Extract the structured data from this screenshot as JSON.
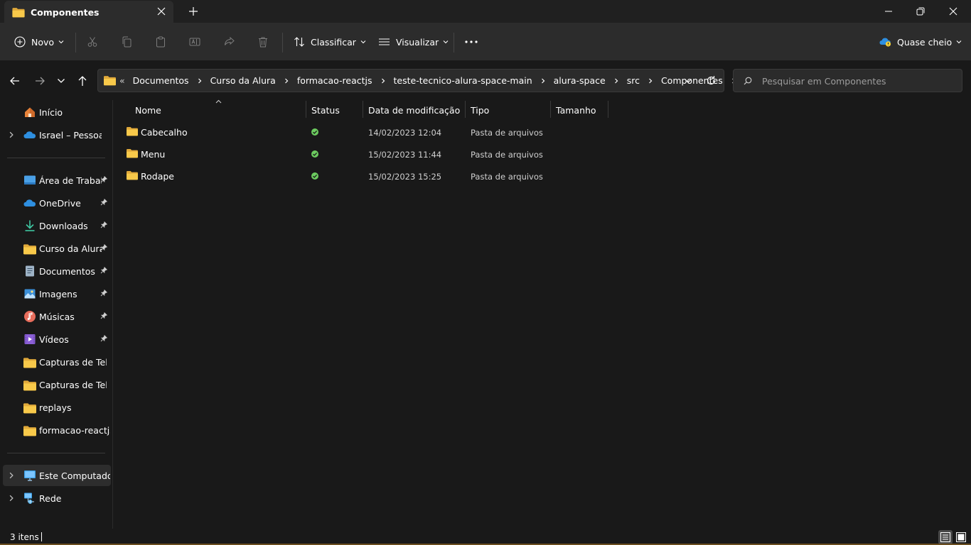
{
  "window": {
    "tab_title": "Componentes",
    "icons": {
      "tab": "folder-icon",
      "close_tab": "close-icon",
      "new_tab": "plus-icon",
      "minimize": "minimize-icon",
      "maximize": "restore-icon",
      "close": "close-icon"
    }
  },
  "toolbar": {
    "new_label": "Novo",
    "sort_label": "Classificar",
    "view_label": "Visualizar",
    "storage_label": "Quase cheio",
    "icons": [
      "cut-icon",
      "copy-icon",
      "paste-icon",
      "rename-icon",
      "share-icon",
      "delete-icon",
      "more-icon"
    ]
  },
  "address": {
    "overflow": "«",
    "crumbs": [
      "Documentos",
      "Curso da Alura",
      "formacao-reactjs",
      "teste-tecnico-alura-space-main",
      "alura-space",
      "src",
      "Componentes"
    ],
    "search_placeholder": "Pesquisar em Componentes"
  },
  "sidebar": {
    "items": [
      {
        "label": "Início",
        "icon": "home-icon"
      },
      {
        "label": "Israel – Pessoal",
        "icon": "onedrive-cloud-icon"
      },
      {
        "label": "Área de Trabalho",
        "icon": "desktop-icon"
      },
      {
        "label": "OneDrive",
        "icon": "onedrive-cloud-icon"
      },
      {
        "label": "Downloads",
        "icon": "download-icon"
      },
      {
        "label": "Curso da Alura",
        "icon": "folder-icon"
      },
      {
        "label": "Documentos",
        "icon": "documents-icon"
      },
      {
        "label": "Imagens",
        "icon": "pictures-icon"
      },
      {
        "label": "Músicas",
        "icon": "music-icon"
      },
      {
        "label": "Vídeos",
        "icon": "videos-icon"
      },
      {
        "label": "Capturas de Tela",
        "icon": "folder-icon"
      },
      {
        "label": "Capturas de Tela",
        "icon": "folder-icon"
      },
      {
        "label": "replays",
        "icon": "folder-icon"
      },
      {
        "label": "formacao-reactjs",
        "icon": "folder-icon"
      },
      {
        "label": "Este Computador",
        "icon": "computer-icon"
      },
      {
        "label": "Rede",
        "icon": "network-icon"
      }
    ]
  },
  "columns": {
    "name": "Nome",
    "status": "Status",
    "date": "Data de modificação",
    "type": "Tipo",
    "size": "Tamanho"
  },
  "files": [
    {
      "name": "Cabecalho",
      "date": "14/02/2023 12:04",
      "type": "Pasta de arquivos",
      "size": ""
    },
    {
      "name": "Menu",
      "date": "15/02/2023 11:44",
      "type": "Pasta de arquivos",
      "size": ""
    },
    {
      "name": "Rodape",
      "date": "15/02/2023 15:25",
      "type": "Pasta de arquivos",
      "size": ""
    }
  ],
  "status": {
    "item_count": "3 itens"
  },
  "colors": {
    "folder": "#f8c94a",
    "synced": "#6ccb5f",
    "accent": "#4cc2ff",
    "background": "#191919"
  }
}
